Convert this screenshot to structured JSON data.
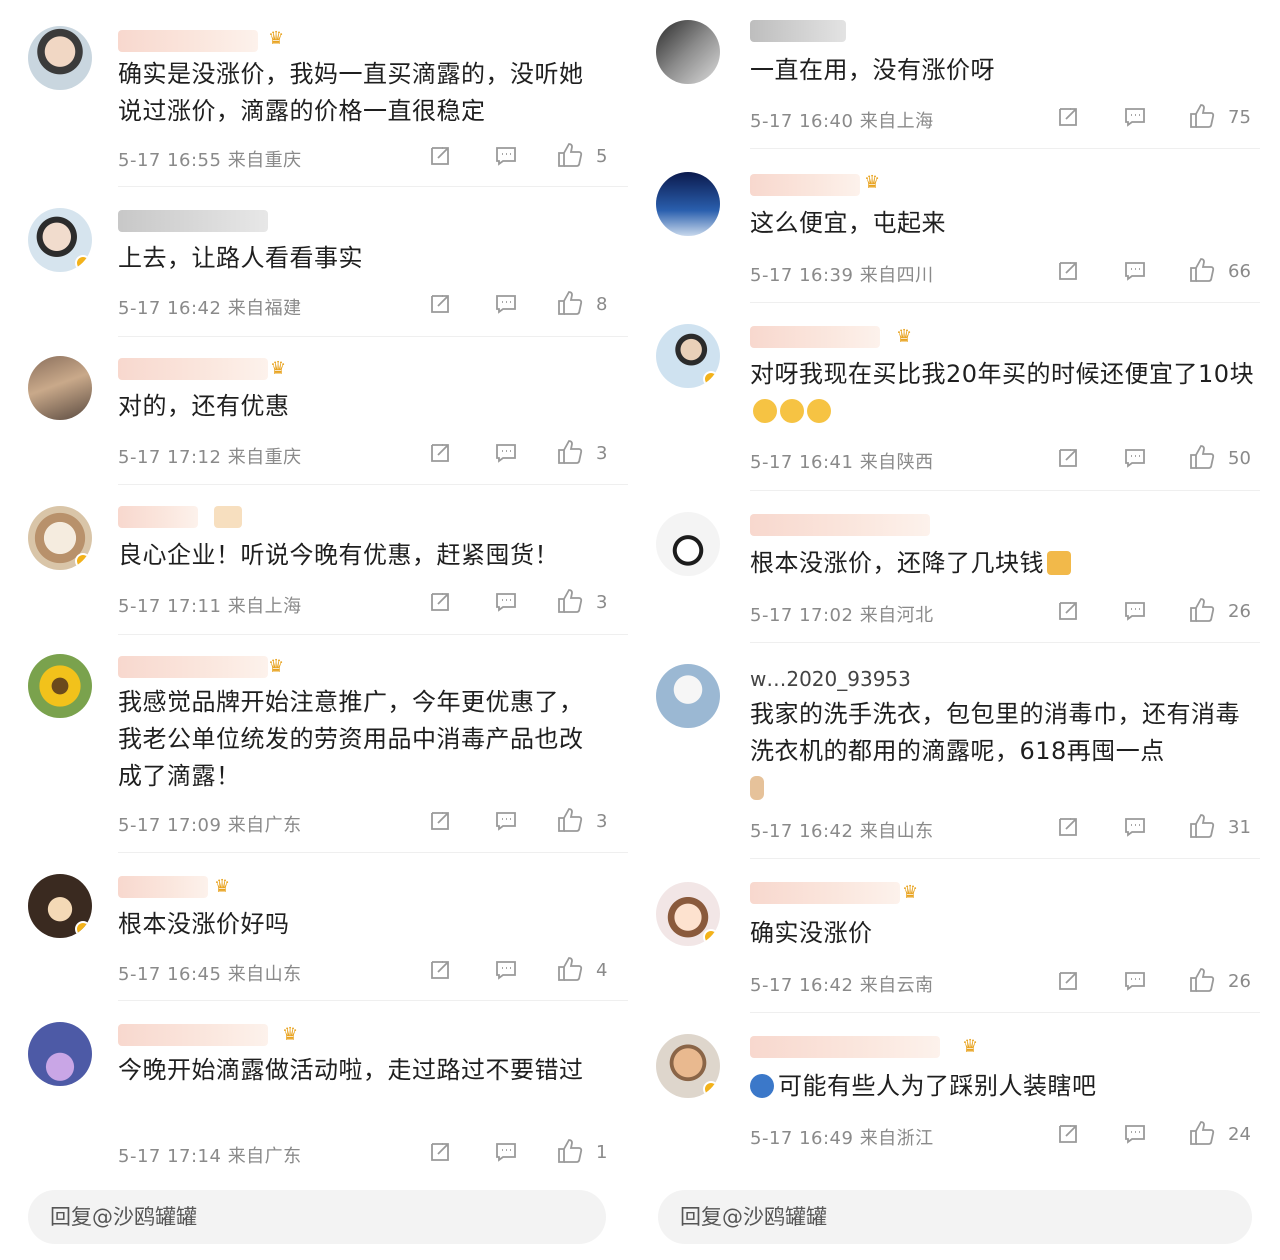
{
  "left": {
    "comments": [
      {
        "username": "",
        "text": "确实是没涨价，我妈一直买滴露的，没听她说过涨价，滴露的价格一直很稳定",
        "time": "5-17 16:55",
        "location": "来自重庆",
        "likes": "5"
      },
      {
        "username": "",
        "text": "上去，让路人看看事实",
        "time": "5-17 16:42",
        "location": "来自福建",
        "likes": "8"
      },
      {
        "username": "",
        "text": "对的，还有优惠",
        "time": "5-17 17:12",
        "location": "来自重庆",
        "likes": "3"
      },
      {
        "username": "",
        "text": "良心企业！听说今晚有优惠，赶紧囤货！",
        "time": "5-17 17:11",
        "location": "来自上海",
        "likes": "3"
      },
      {
        "username": "",
        "text": "我感觉品牌开始注意推广，今年更优惠了，我老公单位统发的劳资用品中消毒产品也改成了滴露！",
        "time": "5-17 17:09",
        "location": "来自广东",
        "likes": "3"
      },
      {
        "username": "",
        "text": "根本没涨价好吗",
        "time": "5-17 16:45",
        "location": "来自山东",
        "likes": "4"
      },
      {
        "username": "",
        "text": "今晚开始滴露做活动啦，走过路过不要错过",
        "time": "5-17 17:14",
        "location": "来自广东",
        "likes": "1"
      }
    ],
    "reply_placeholder": "回复@沙鸥罐罐"
  },
  "right": {
    "comments": [
      {
        "username": "",
        "text": "一直在用，没有涨价呀",
        "time": "5-17 16:40",
        "location": "来自上海",
        "likes": "75"
      },
      {
        "username": "",
        "text": "这么便宜，屯起来",
        "time": "5-17 16:39",
        "location": "来自四川",
        "likes": "66"
      },
      {
        "username": "",
        "text": "对呀我现在买比我20年买的时候还便宜了10块",
        "time": "5-17 16:41",
        "location": "来自陕西",
        "likes": "50"
      },
      {
        "username": "",
        "text": "根本没涨价，还降了几块钱",
        "time": "5-17 17:02",
        "location": "来自河北",
        "likes": "26"
      },
      {
        "username": "w…2020_93953",
        "text": "我家的洗手洗衣，包包里的消毒巾，还有消毒洗衣机的都用的滴露呢，618再囤一点",
        "time": "5-17 16:42",
        "location": "来自山东",
        "likes": "31"
      },
      {
        "username": "",
        "text": "确实没涨价",
        "time": "5-17 16:42",
        "location": "来自云南",
        "likes": "26"
      },
      {
        "username": "",
        "text": "可能有些人为了踩别人装瞎吧",
        "time": "5-17 16:49",
        "location": "来自浙江",
        "likes": "24"
      }
    ],
    "reply_placeholder": "回复@沙鸥罐罐"
  },
  "colors": {
    "badge": "#f3b21a",
    "meta": "#8a8a8a",
    "divider": "#efefef",
    "reply_bg": "#f3f3f3"
  },
  "icons": {
    "share": "share-icon",
    "comment": "comment-icon",
    "like": "thumbs-up-icon",
    "crown": "crown-icon",
    "verified": "verified-badge-icon"
  }
}
